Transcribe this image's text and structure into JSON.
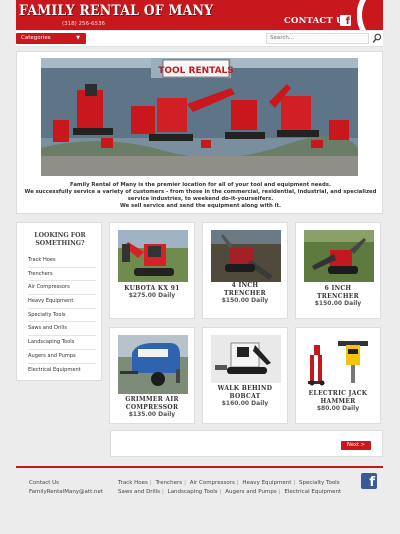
{
  "header": {
    "logo_text": "FAMILY RENTAL OF MANY",
    "phone": "(318) 256-6536",
    "contact_text": "CONTACT US",
    "facebook_icon": "f"
  },
  "nav": {
    "categories_label": "Categories",
    "search_placeholder": "Search..."
  },
  "banner": {
    "sign_text": "TOOL RENTALS",
    "intro_lines": [
      "Family Rental of Many is the premier location for all of your tool and equipment needs.",
      "We successfully service a variety of customers - from those in the commercial, residential, industrial, and specialized",
      "service industries, to weekend do-it-yourselfers.",
      "We sell service and send the equipment along with it."
    ]
  },
  "sidebar": {
    "title_line1": "LOOKING FOR",
    "title_line2": "SOMETHING?",
    "items": [
      "Track Hoes",
      "Trenchers",
      "Air Compressors",
      "Heavy Equipment",
      "Specialty Tools",
      "Saws and Drills",
      "Landscaping Tools",
      "Augers and Pumps",
      "Electrical Equipment"
    ]
  },
  "products": [
    {
      "line1": "KUBOTA KX 91",
      "line2": "",
      "price": "$275.00 Daily"
    },
    {
      "line1": "4 INCH",
      "line2": "TRENCHER",
      "price": "$150.00 Daily"
    },
    {
      "line1": "6 INCH",
      "line2": "TRENCHER",
      "price": "$150.00 Daily"
    },
    {
      "line1": "GRIMMER AIR",
      "line2": "COMPRESSOR",
      "price": "$135.00 Daily"
    },
    {
      "line1": "WALK BEHIND",
      "line2": "BOBCAT",
      "price": "$160.00 Daily"
    },
    {
      "line1": "ELECTRIC JACK",
      "line2": "HAMMER",
      "price": "$80.00 Daily"
    }
  ],
  "pager": {
    "next_label": "Next >"
  },
  "footer": {
    "contact_label": "Contact Us",
    "email": "FamilyRentalMany@att.net",
    "links": [
      "Track Hoes",
      "Trenchers",
      "Air Compressors",
      "Heavy Equipment",
      "Specialty Tools",
      "Saws and Drills",
      "Landscaping Tools",
      "Augers and Pumps",
      "Electrical Equipment"
    ],
    "facebook_icon": "f"
  },
  "colors": {
    "brand_red": "#c8171d",
    "facebook_blue": "#3b5998",
    "background": "#ececec"
  },
  "icons": [
    "facebook-icon",
    "dropdown-arrow-icon",
    "search-icon"
  ]
}
